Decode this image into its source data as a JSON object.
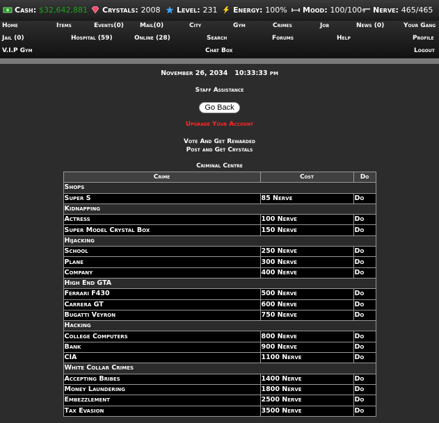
{
  "stats": {
    "cash_label": "Cash:",
    "cash_value": "$32,642,881",
    "crystals_label": "Crystals:",
    "crystals_value": "2008",
    "level_label": "Level:",
    "level_value": "231",
    "energy_label": "Energy:",
    "energy_value": "100%",
    "mood_label": "Mood:",
    "mood_value": "100/100",
    "nerve_label": "Nerve:",
    "nerve_value": "465/465",
    "colors": {
      "cash": "#1fa31f",
      "crystal": "#ff4a6a",
      "star": "#3aa7ff",
      "bolt": "#ffd21a"
    }
  },
  "nav": {
    "row1": [
      "Home",
      "Items",
      "Events(0)",
      "Mail(0)",
      "City",
      "Gym",
      "Crimes",
      "Job",
      "News (0)",
      "Your Gang"
    ],
    "row2": [
      "Jail (0)",
      "Hospital (59)",
      "Online (28)",
      "Search",
      "Forums",
      "Help",
      "Profile"
    ],
    "row3": [
      "V.I.P Gym",
      "Chat Box",
      "Logout"
    ]
  },
  "main": {
    "datetime": "November 26, 2034   10:33:33 pm",
    "staff": "Staff Assistance",
    "go_back": "Go Back",
    "upgrade": "Upgrade Your Account",
    "vote1": "Vote And Get Rewarded",
    "vote2": "Post and Get Crystals",
    "section_title": "Criminal Centre"
  },
  "table": {
    "headers": [
      "Crime",
      "Cost",
      "Do"
    ],
    "groups": [
      {
        "name": "Shops",
        "rows": [
          [
            "Super S",
            "85 Nerve",
            "Do"
          ]
        ]
      },
      {
        "name": "Kidnapping",
        "rows": [
          [
            "Actress",
            "100 Nerve",
            "Do"
          ],
          [
            "Super Model Crystal Box",
            "150 Nerve",
            "Do"
          ]
        ]
      },
      {
        "name": "Hijacking",
        "rows": [
          [
            "School",
            "250 Nerve",
            "Do"
          ],
          [
            "Plane",
            "300 Nerve",
            "Do"
          ],
          [
            "Company",
            "400 Nerve",
            "Do"
          ]
        ]
      },
      {
        "name": "High End GTA",
        "rows": [
          [
            "Ferrari F430",
            "500 Nerve",
            "Do"
          ],
          [
            "Carrera GT",
            "600 Nerve",
            "Do"
          ],
          [
            "Bugatti Veyron",
            "750 Nerve",
            "Do"
          ]
        ]
      },
      {
        "name": "Hacking",
        "rows": [
          [
            "College Computers",
            "800 Nerve",
            "Do"
          ],
          [
            "Bank",
            "900 Nerve",
            "Do"
          ],
          [
            "CIA",
            "1100 Nerve",
            "Do"
          ]
        ]
      },
      {
        "name": "White Collar Crimes",
        "rows": [
          [
            "Accepting Bribes",
            "1400 Nerve",
            "Do"
          ],
          [
            "Money Laundering",
            "1800 Nerve",
            "Do"
          ],
          [
            "Embezzlement",
            "2500 Nerve",
            "Do"
          ],
          [
            "Tax Evasion",
            "3500 Nerve",
            "Do"
          ]
        ]
      }
    ]
  }
}
